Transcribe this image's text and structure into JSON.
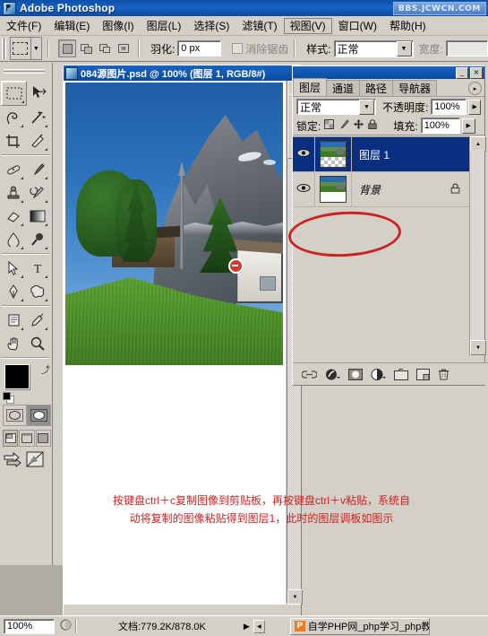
{
  "app": {
    "title": "Adobe Photoshop",
    "icon": "photoshop-icon",
    "watermark": "BBS.JCWCN.COM"
  },
  "menubar": {
    "items": [
      {
        "label": "文件(F)",
        "active": false
      },
      {
        "label": "编辑(E)",
        "active": false
      },
      {
        "label": "图像(I)",
        "active": false
      },
      {
        "label": "图层(L)",
        "active": false
      },
      {
        "label": "选择(S)",
        "active": false
      },
      {
        "label": "滤镜(T)",
        "active": false
      },
      {
        "label": "视图(V)",
        "active": true
      },
      {
        "label": "窗口(W)",
        "active": false
      },
      {
        "label": "帮助(H)",
        "active": false
      }
    ]
  },
  "options_bar": {
    "tool": "rectangular-marquee",
    "feather_label": "羽化:",
    "feather_value": "0 px",
    "antialias_label": "消除锯齿",
    "antialias_checked": false,
    "style_label": "样式:",
    "style_value": "正常",
    "width_label": "宽度:",
    "width_value": ""
  },
  "toolbox": {
    "tools": [
      {
        "name": "rectangular-marquee-tool",
        "selected": true
      },
      {
        "name": "move-tool",
        "selected": false
      },
      {
        "name": "lasso-tool",
        "selected": false
      },
      {
        "name": "magic-wand-tool",
        "selected": false
      },
      {
        "name": "crop-tool",
        "selected": false
      },
      {
        "name": "slice-tool",
        "selected": false
      },
      {
        "name": "healing-brush-tool",
        "selected": false
      },
      {
        "name": "brush-tool",
        "selected": false
      },
      {
        "name": "clone-stamp-tool",
        "selected": false
      },
      {
        "name": "history-brush-tool",
        "selected": false
      },
      {
        "name": "eraser-tool",
        "selected": false
      },
      {
        "name": "gradient-tool",
        "selected": false
      },
      {
        "name": "blur-tool",
        "selected": false
      },
      {
        "name": "dodge-tool",
        "selected": false
      },
      {
        "name": "path-selection-tool",
        "selected": false
      },
      {
        "name": "type-tool",
        "selected": false
      },
      {
        "name": "pen-tool",
        "selected": false
      },
      {
        "name": "custom-shape-tool",
        "selected": false
      },
      {
        "name": "notes-tool",
        "selected": false
      },
      {
        "name": "eyedropper-tool",
        "selected": false
      },
      {
        "name": "hand-tool",
        "selected": false
      },
      {
        "name": "zoom-tool",
        "selected": false
      }
    ],
    "foreground_color": "#000000",
    "background_color": "#ffffff",
    "quickmask": {
      "standard_selected": true,
      "quickmask_selected": false
    },
    "screenmode": {
      "standard_selected": true
    }
  },
  "document": {
    "title": "084源图片.psd @ 100% (图层 1, RGB/8#)",
    "zoom": "100%",
    "doc_size": "文档:779.2K/878.0K"
  },
  "layers_panel": {
    "tabs": [
      {
        "label": "图层",
        "active": true
      },
      {
        "label": "通道",
        "active": false
      },
      {
        "label": "路径",
        "active": false
      },
      {
        "label": "导航器",
        "active": false
      }
    ],
    "blend_mode": "正常",
    "opacity_label": "不透明度:",
    "opacity_value": "100%",
    "lock_label": "锁定:",
    "fill_label": "填充:",
    "fill_value": "100%",
    "lock_buttons": [
      "lock-transparent-pixels-icon",
      "lock-image-pixels-icon",
      "lock-position-icon",
      "lock-all-icon"
    ],
    "layers": [
      {
        "name": "图层 1",
        "selected": true,
        "visible": true,
        "locked": false,
        "italic": false
      },
      {
        "name": "背景",
        "selected": false,
        "visible": true,
        "locked": true,
        "italic": true
      }
    ],
    "bottom_buttons": [
      "link-layers-icon",
      "layer-style-fx-icon",
      "layer-mask-icon",
      "adjustment-layer-icon",
      "new-group-icon",
      "new-layer-icon",
      "delete-layer-icon"
    ],
    "annotation_shape": "red-ellipse-highlight"
  },
  "annotation": {
    "line1": "按键盘ctrl＋c复制图像到剪贴板，再按键盘ctrl＋v粘贴，系统自",
    "line2": "动将复制的图像粘贴得到图层1，此时的图层调板如图示",
    "color": "#cc2222"
  },
  "taskbar": {
    "item_label": "自学PHP网_php学习_php教",
    "item_icon": "P"
  }
}
